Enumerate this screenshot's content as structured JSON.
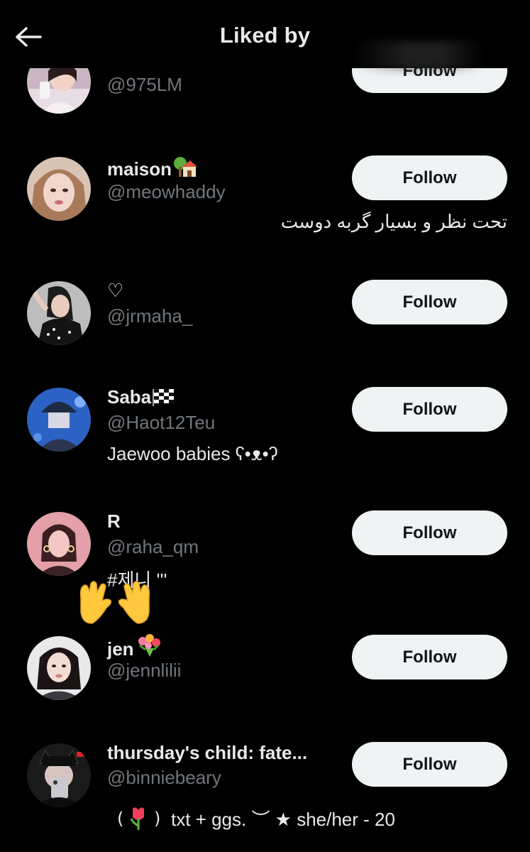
{
  "header": {
    "title": "Liked by"
  },
  "users": [
    {
      "name": "",
      "handle": "@975LM",
      "bio": "",
      "follow_label": "Follow"
    },
    {
      "name": "maison",
      "handle": "@meowhaddy",
      "bio": "تحت نظر و بسیار گربه دوست",
      "follow_label": "Follow"
    },
    {
      "name": "♡",
      "handle": "@jrmaha_",
      "bio": "",
      "follow_label": "Follow"
    },
    {
      "name": "Saba",
      "handle": "@Haot12Teu",
      "bio": "Jaewoo babies ʕ•ᴥ•ʔ",
      "follow_label": "Follow"
    },
    {
      "name": "R",
      "handle": "@raha_qm",
      "bio": "#제니 '''",
      "follow_label": "Follow"
    },
    {
      "name": "jen",
      "handle": "@jennlilii",
      "bio": "",
      "follow_label": "Follow"
    },
    {
      "name": "thursday's child: fate...",
      "handle": "@binniebeary",
      "bio": "txt + ggs. ︶ ★ she/her - 20",
      "follow_label": "Follow"
    }
  ],
  "icons": {
    "back": "arrow-left-icon",
    "house": "house-tree-emoji",
    "flag": "checkered-flag-emoji",
    "hands": "raising-hands-emoji",
    "bouquet": "bouquet-emoji",
    "tulip": "tulip-emoji"
  },
  "colors": {
    "background": "#000000",
    "text": "#e7e9ea",
    "secondary": "#71767b",
    "button": "#eff3f4"
  }
}
